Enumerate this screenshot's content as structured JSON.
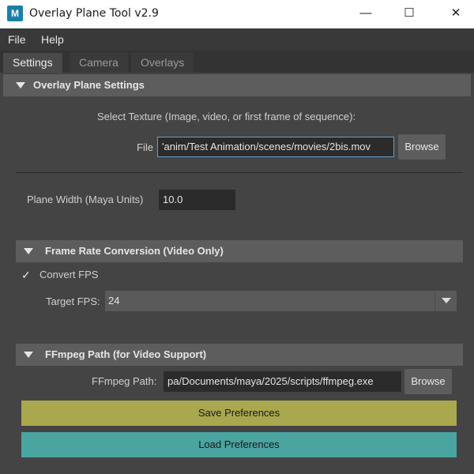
{
  "window": {
    "icon_letter": "M",
    "title": "Overlay Plane Tool v2.9",
    "minimize_glyph": "—",
    "maximize_glyph": "☐",
    "close_glyph": "✕"
  },
  "menu": {
    "items": [
      {
        "label": "File"
      },
      {
        "label": "Help"
      }
    ]
  },
  "tabs": [
    {
      "label": "Settings",
      "active": true
    },
    {
      "label": "Camera",
      "active": false
    },
    {
      "label": "Overlays",
      "active": false
    }
  ],
  "overlay_section": {
    "title": "Overlay Plane Settings",
    "select_texture_label": "Select Texture (Image, video, or first frame of sequence):",
    "file_label": "File",
    "file_value": "'anim/Test Animation/scenes/movies/2bis.mov",
    "browse_label": "Browse",
    "plane_width_label": "Plane Width (Maya Units)",
    "plane_width_value": "10.0"
  },
  "frame_rate_section": {
    "title": "Frame Rate Conversion (Video Only)",
    "convert_fps_label": "Convert FPS",
    "convert_fps_checked": true,
    "target_fps_label": "Target FPS:",
    "target_fps_value": "24"
  },
  "ffmpeg_section": {
    "title": "FFmpeg Path (for Video Support)",
    "path_label": "FFmpeg Path:",
    "path_value": "pa/Documents/maya/2025/scripts/ffmpeg.exe",
    "browse_label": "Browse"
  },
  "actions": {
    "save_label": "Save Preferences",
    "load_label": "Load Preferences"
  },
  "colors": {
    "save_button": "#a9a84f",
    "load_button": "#4aa4a0",
    "focus_border": "#5fa1d6",
    "app_icon": "#1a7fa7"
  }
}
